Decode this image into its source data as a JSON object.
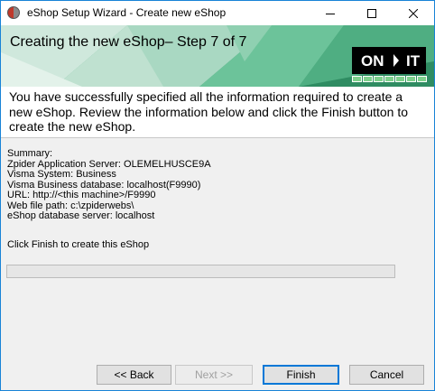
{
  "window": {
    "title": "eShop Setup Wizard - Create new eShop",
    "icon": "app-logo-icon"
  },
  "banner": {
    "title": "Creating the new eShop– Step 7 of 7",
    "logo_left": "ON",
    "logo_right": "IT",
    "step_current": 7,
    "step_total": 7,
    "accent_color": "#2e8e63",
    "progress_color": "#7ed08c"
  },
  "intro": {
    "text": "You have successfully specified all the information required to create a new eShop. Review the information below and click the Finish button to create the new eShop."
  },
  "summary": {
    "heading": "Summary:",
    "lines": [
      "Zpider Application Server: OLEMELHUSCE9A",
      "Visma System: Business",
      "Visma Business database: localhost(F9990)",
      "URL: http://<this machine>/F9990",
      "Web file path: c:\\zpiderwebs\\",
      "eShop database server: localhost"
    ]
  },
  "instruction": "Click Finish to create this eShop",
  "progress": {
    "value": 0
  },
  "buttons": {
    "back": "<< Back",
    "next": "Next >>",
    "finish": "Finish",
    "cancel": "Cancel"
  }
}
